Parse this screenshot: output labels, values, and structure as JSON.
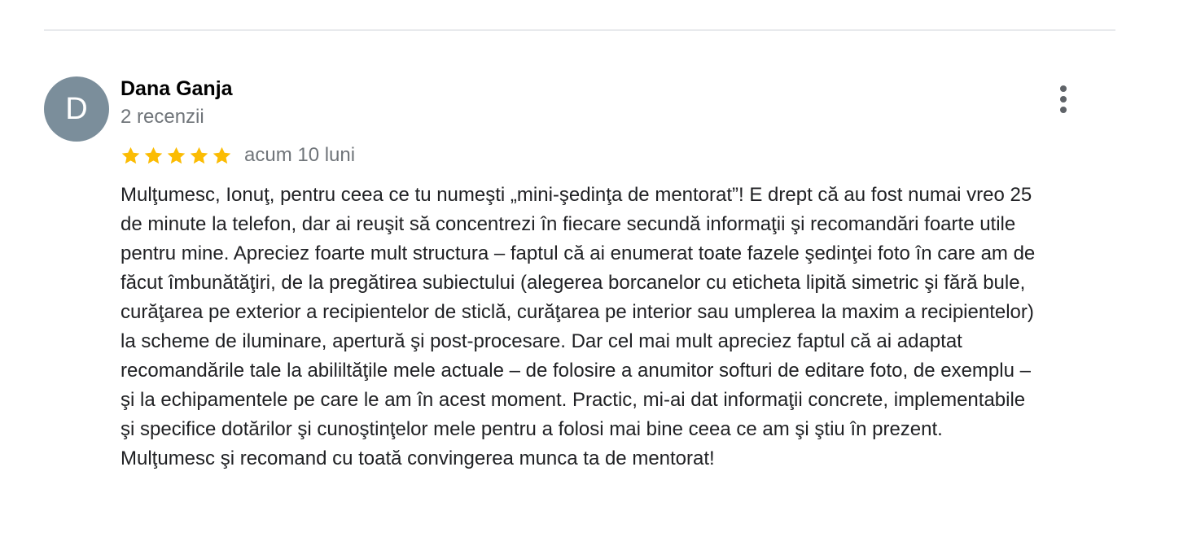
{
  "review": {
    "avatar_letter": "D",
    "avatar_color": "#7b8e9b",
    "reviewer_name": "Dana Ganja",
    "review_count": "2 recenzii",
    "rating": 5,
    "rating_max": 5,
    "star_color": "#fbbc04",
    "date": "acum 10 luni",
    "more_icon": "more-vert-icon",
    "text": "Mulţumesc, Ionuţ, pentru ceea ce tu numeşti „mini-şedinţa de mentorat”! E drept că au fost numai vreo 25\nde minute la telefon, dar ai reuşit să concentrezi în fiecare secundă informaţii şi recomandări foarte utile\npentru mine. Apreciez foarte mult structura – faptul că ai enumerat toate fazele şedinţei foto în care am de\nfăcut îmbunătăţiri, de la pregătirea subiectului (alegerea borcanelor cu eticheta lipită simetric şi fără bule,\ncurăţarea pe exterior a recipientelor de sticlă, curăţarea pe interior sau umplerea la maxim a recipientelor)\nla scheme de iluminare, apertură şi post-procesare. Dar cel mai mult apreciez faptul că ai adaptat\nrecomandările tale la abililtăţile mele actuale – de folosire a anumitor softuri de editare foto, de exemplu –\nşi la echipamentele pe care le am în acest moment. Practic, mi-ai dat informaţii concrete, implementabile\nşi specifice dotărilor şi cunoştinţelor mele pentru a folosi mai bine ceea ce am şi ştiu în prezent.\nMulţumesc şi recomand cu toată convingerea munca ta de mentorat!"
  }
}
